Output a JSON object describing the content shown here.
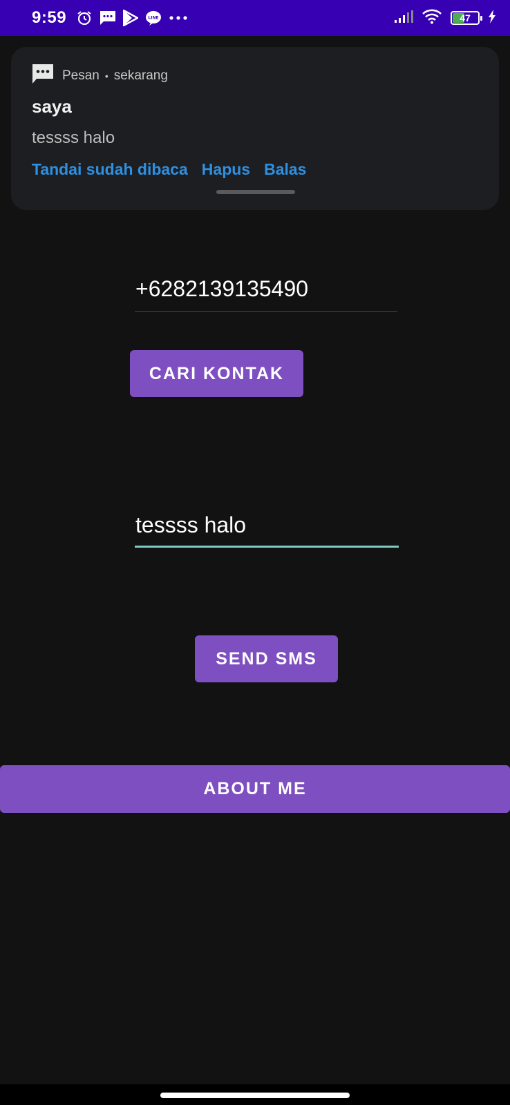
{
  "status_bar": {
    "time": "9:59",
    "battery_level": "47",
    "icons": [
      "alarm-icon",
      "messages-icon",
      "play-store-icon",
      "line-icon",
      "more-dots-icon",
      "signal-icon",
      "wifi-icon",
      "battery-icon",
      "charging-icon"
    ]
  },
  "notification": {
    "app_name": "Pesan",
    "time": "sekarang",
    "title": "saya",
    "body": "tessss halo",
    "actions": [
      "Tandai sudah dibaca",
      "Hapus",
      "Balas"
    ]
  },
  "form": {
    "phone_value": "+6282139135490",
    "find_contact_label": "CARI KONTAK",
    "message_value": "tessss halo",
    "send_label": "SEND SMS",
    "about_label": "ABOUT ME"
  },
  "colors": {
    "status_bar": "#3700b3",
    "background": "#121212",
    "button": "#7e4fc0",
    "focus_underline": "#80cbc4",
    "notif_action": "#2f8fe0"
  }
}
